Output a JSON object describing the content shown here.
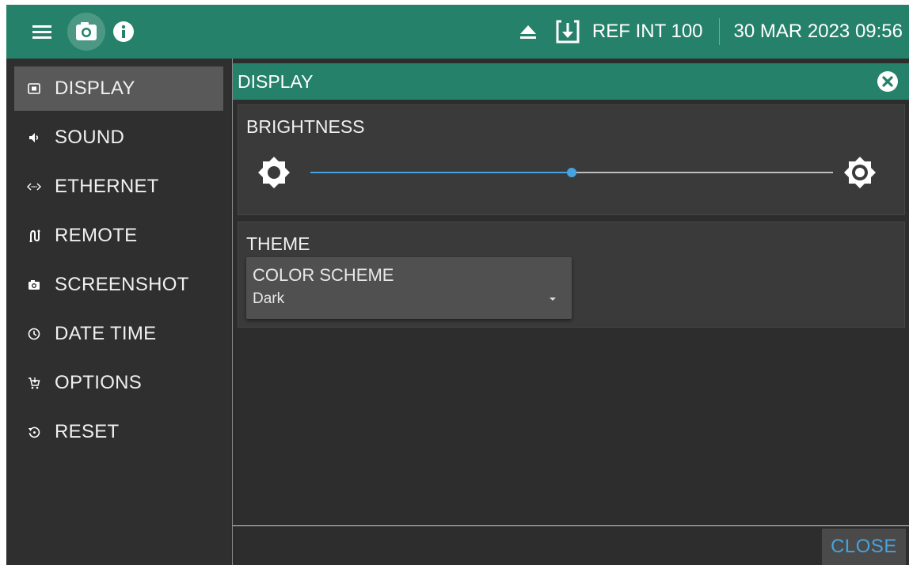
{
  "topbar": {
    "icons": [
      "menu-icon",
      "camera-icon",
      "info-icon",
      "eject-icon",
      "save-download-icon"
    ],
    "reference": "REF INT 100",
    "datetime": "30 MAR 2023 09:56"
  },
  "sidebar": {
    "items": [
      {
        "label": "DISPLAY",
        "icon": "display-icon",
        "active": true
      },
      {
        "label": "SOUND",
        "icon": "speaker-icon",
        "active": false
      },
      {
        "label": "ETHERNET",
        "icon": "ethernet-icon",
        "active": false
      },
      {
        "label": "REMOTE",
        "icon": "remote-icon",
        "active": false
      },
      {
        "label": "SCREENSHOT",
        "icon": "camera-icon",
        "active": false
      },
      {
        "label": "DATE TIME",
        "icon": "clock-icon",
        "active": false
      },
      {
        "label": "OPTIONS",
        "icon": "cart-icon",
        "active": false
      },
      {
        "label": "RESET",
        "icon": "reset-icon",
        "active": false
      }
    ]
  },
  "panel": {
    "title": "DISPLAY",
    "brightness": {
      "label": "BRIGHTNESS",
      "level": 0.5
    },
    "theme": {
      "label": "THEME",
      "color_scheme": {
        "label": "COLOR SCHEME",
        "value": "Dark"
      }
    },
    "close_label": "CLOSE"
  },
  "colors": {
    "accent_green": "#26816b",
    "slider_blue": "#45a3e0",
    "background": "#2d2d2d"
  }
}
